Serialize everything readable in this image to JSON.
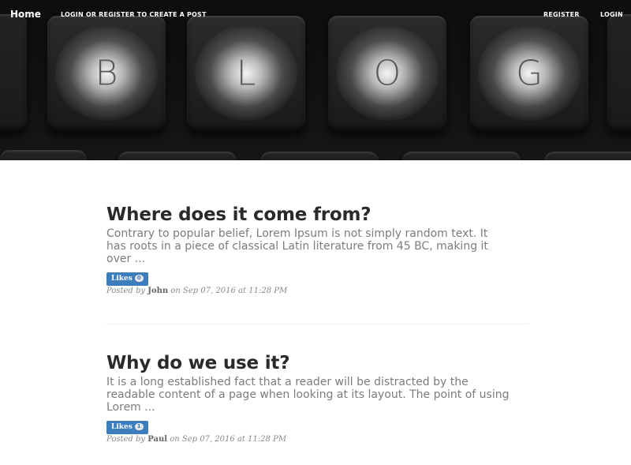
{
  "nav": {
    "home": "Home",
    "login_or_register": "LOGIN OR REGISTER TO CREATE A POST",
    "register": "REGISTER",
    "login": "LOGIN"
  },
  "hero": {
    "letters": [
      "B",
      "L",
      "O",
      "G"
    ]
  },
  "posts": [
    {
      "title": "Where does it come from?",
      "excerpt_lines": [
        "Contrary to popular belief, Lorem Ipsum is not simply random text. It",
        "has roots in a piece of classical Latin literature from 45 BC, making it",
        "over ..."
      ],
      "likes_label": "Likes",
      "likes_count": "0",
      "posted_by": "Posted by",
      "author": "John",
      "date_text": "on Sep 07, 2016 at 11:28 PM"
    },
    {
      "title": "Why do we use it?",
      "excerpt_lines": [
        "It is a long established fact that a reader will be distracted by the",
        "readable content of a page when looking at its layout. The point of using",
        "Lorem ..."
      ],
      "likes_label": "Likes",
      "likes_count": "1",
      "posted_by": "Posted by",
      "author": "Paul",
      "date_text": "on Sep 07, 2016 at 11:28 PM"
    }
  ],
  "colors": {
    "likes_button": "#3b7dbd",
    "title": "#2a2a2a",
    "excerpt": "#7c7c7c"
  }
}
